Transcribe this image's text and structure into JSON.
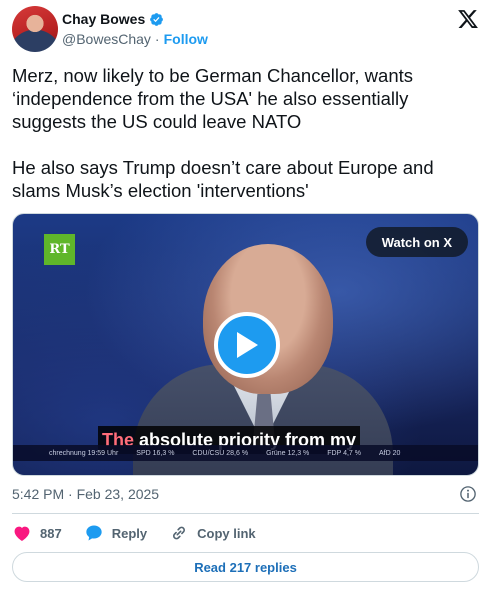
{
  "author": {
    "display_name": "Chay Bowes",
    "handle": "@BowesChay",
    "separator": "·",
    "follow_label": "Follow",
    "verified_color": "#1d9bf0"
  },
  "tweet": {
    "paragraphs": [
      "Merz, now likely to be German Chancellor, wants ‘independence from the USA' he also essentially suggests the US could leave NATO",
      "He also says Trump doesn’t care about Europe and slams Musk’s election 'interventions'"
    ]
  },
  "media": {
    "channel_logo": "RT",
    "watch_label": "Watch on X",
    "caption_highlight": "The",
    "caption_rest": "absolute priority from my",
    "ticker": [
      "chrechnung 19:59 Uhr",
      "SPD 16,3 %",
      "CDU/CSU 28,6 %",
      "Grüne 12,3 %",
      "FDP 4,7 %",
      "AfD 20"
    ],
    "play_icon": "play-icon"
  },
  "meta": {
    "timestamp": "5:42 PM · Feb 23, 2025",
    "info_icon": "info-icon"
  },
  "actions": {
    "likes_count": "887",
    "reply_label": "Reply",
    "copy_label": "Copy link",
    "like_color": "#f91880"
  },
  "read_replies_label": "Read 217 replies"
}
